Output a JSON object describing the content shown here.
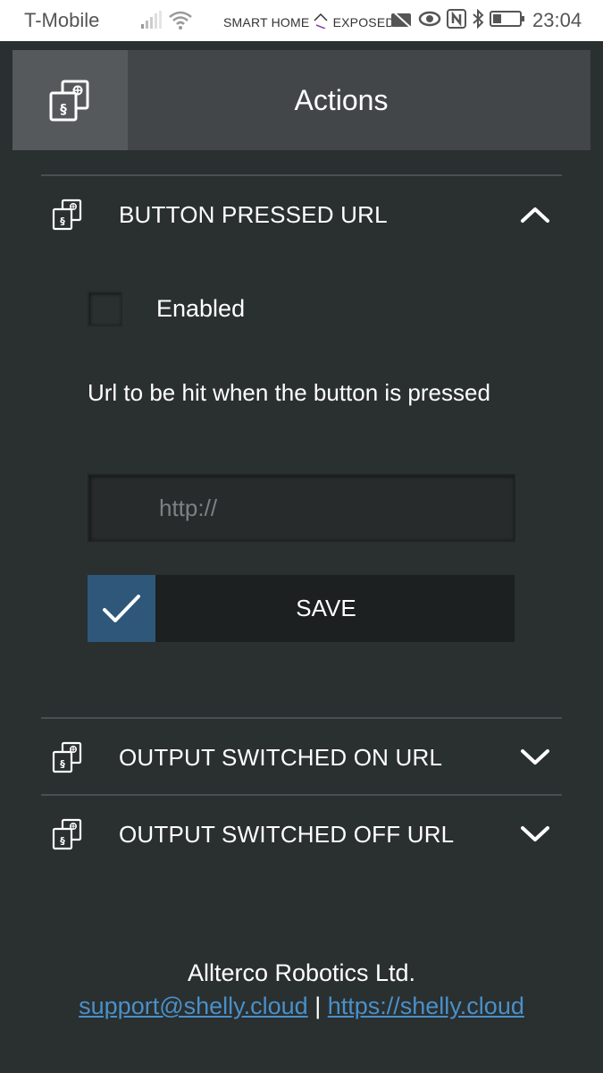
{
  "status_bar": {
    "carrier": "T-Mobile",
    "brand_left": "SMART HOME",
    "brand_right": "EXPOSED",
    "time": "23:04"
  },
  "header": {
    "title": "Actions",
    "icon": "shelly-device-icon"
  },
  "sections": [
    {
      "title": "BUTTON PRESSED URL",
      "expanded": true,
      "icon": "shelly-device-icon"
    },
    {
      "title": "OUTPUT SWITCHED ON URL",
      "expanded": false,
      "icon": "shelly-device-icon"
    },
    {
      "title": "OUTPUT SWITCHED OFF URL",
      "expanded": false,
      "icon": "shelly-device-icon"
    }
  ],
  "button_pressed": {
    "enabled_label": "Enabled",
    "enabled": false,
    "description": "Url to be hit when the button is pressed",
    "url_placeholder": "http://",
    "url_value": "",
    "save_label": "SAVE"
  },
  "footer": {
    "company": "Allterco Robotics Ltd.",
    "support_email": "support@shelly.cloud",
    "separator": "|",
    "website": "https://shelly.cloud"
  },
  "colors": {
    "background": "#2a2f30",
    "header": "#424648",
    "accent": "#2e5779",
    "link": "#4a90c8"
  }
}
